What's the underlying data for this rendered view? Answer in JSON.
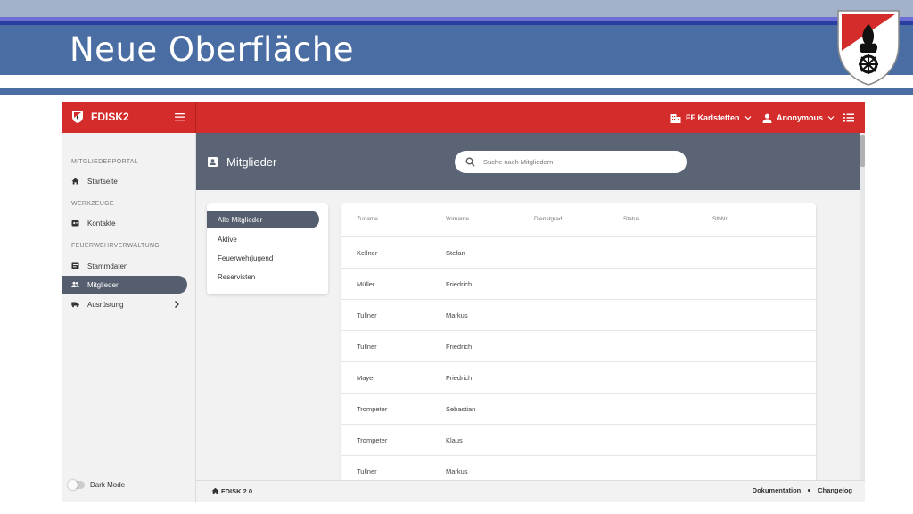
{
  "slide": {
    "title": "Neue Oberfläche"
  },
  "app": {
    "brand": "FDISK2",
    "organization": "FF Karlstetten",
    "user": "Anonymous",
    "colors": {
      "primary": "#d42b2b",
      "header": "#5b6475",
      "active": "#555e6e"
    }
  },
  "sidebar": {
    "sections": [
      {
        "label": "MITGLIEDERPORTAL",
        "items": [
          {
            "label": "Startseite",
            "icon": "home-icon"
          }
        ]
      },
      {
        "label": "WERKZEUGE",
        "items": [
          {
            "label": "Kontakte",
            "icon": "contacts-icon"
          }
        ]
      },
      {
        "label": "FEUERWEHRVERWALTUNG",
        "items": [
          {
            "label": "Stammdaten",
            "icon": "database-icon"
          },
          {
            "label": "Mitglieder",
            "icon": "people-icon",
            "active": true
          },
          {
            "label": "Ausrüstung",
            "icon": "truck-icon",
            "expandable": true
          }
        ]
      }
    ],
    "dark_mode_label": "Dark Mode"
  },
  "page": {
    "title": "Mitglieder",
    "search_placeholder": "Suche nach Mitgliedern"
  },
  "filters": [
    "Alle Mitglieder",
    "Aktive",
    "Feuerwehrjugend",
    "Reservisten"
  ],
  "table": {
    "columns": [
      "Zuname",
      "Vorname",
      "Dienstgrad",
      "Status",
      "StbNr."
    ],
    "rows": [
      [
        "Kellner",
        "Stefan"
      ],
      [
        "Müller",
        "Friedrich"
      ],
      [
        "Tullner",
        "Markus"
      ],
      [
        "Tullner",
        "Friedrich"
      ],
      [
        "Mayer",
        "Friedrich"
      ],
      [
        "Trompeter",
        "Sebastian"
      ],
      [
        "Trompeter",
        "Klaus"
      ],
      [
        "Tullner",
        "Markus"
      ]
    ]
  },
  "footer": {
    "version": "FDISK 2.0",
    "links": [
      "Dokumentation",
      "Changelog"
    ]
  }
}
